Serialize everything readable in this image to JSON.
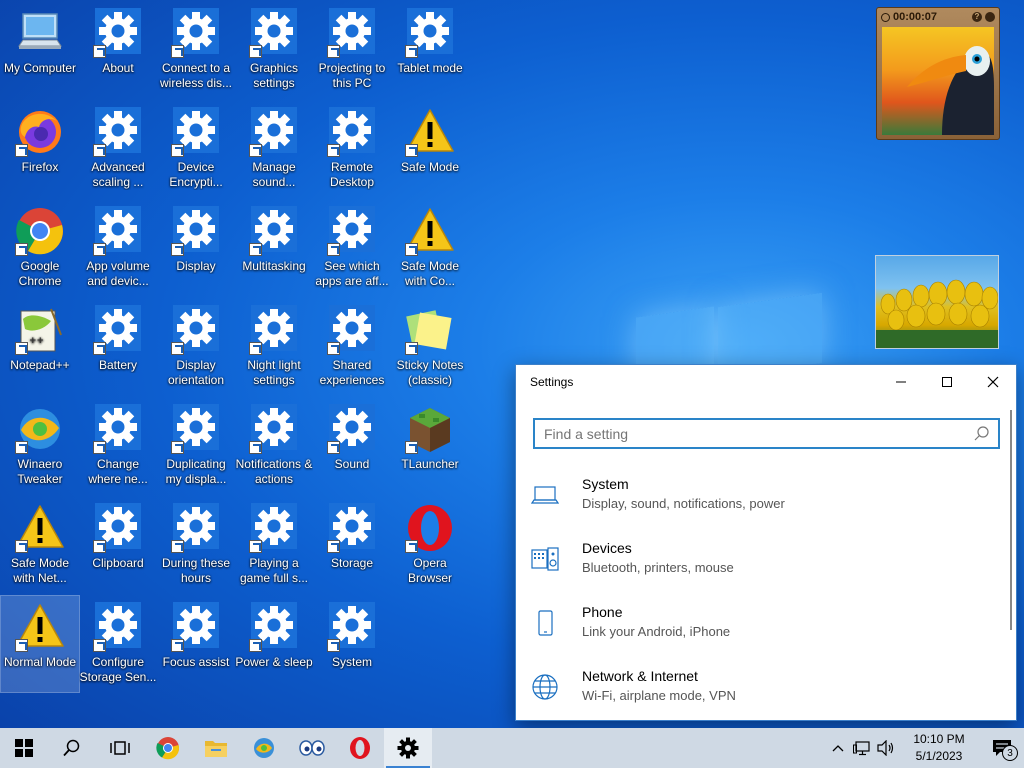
{
  "desktop": {
    "icons": [
      {
        "label": "My Computer",
        "type": "computer"
      },
      {
        "label": "About",
        "type": "gear"
      },
      {
        "label": "Connect to a wireless dis...",
        "type": "gear"
      },
      {
        "label": "Graphics settings",
        "type": "gear"
      },
      {
        "label": "Projecting to this PC",
        "type": "gear"
      },
      {
        "label": "Tablet mode",
        "type": "gear"
      },
      {
        "label": "Firefox",
        "type": "firefox"
      },
      {
        "label": "Advanced scaling ...",
        "type": "gear"
      },
      {
        "label": "Device Encrypti...",
        "type": "gear"
      },
      {
        "label": "Manage sound...",
        "type": "gear"
      },
      {
        "label": "Remote Desktop",
        "type": "gear"
      },
      {
        "label": "Safe Mode",
        "type": "warning"
      },
      {
        "label": "Google Chrome",
        "type": "chrome"
      },
      {
        "label": "App volume and devic...",
        "type": "gear"
      },
      {
        "label": "Display",
        "type": "gear"
      },
      {
        "label": "Multitasking",
        "type": "gear"
      },
      {
        "label": "See which apps are aff...",
        "type": "gear"
      },
      {
        "label": "Safe Mode with Co...",
        "type": "warning"
      },
      {
        "label": "Notepad++",
        "type": "notepad"
      },
      {
        "label": "Battery",
        "type": "gear"
      },
      {
        "label": "Display orientation",
        "type": "gear"
      },
      {
        "label": "Night light settings",
        "type": "gear"
      },
      {
        "label": "Shared experiences",
        "type": "gear"
      },
      {
        "label": "Sticky Notes (classic)",
        "type": "sticky"
      },
      {
        "label": "Winaero Tweaker",
        "type": "winaero"
      },
      {
        "label": "Change where ne...",
        "type": "gear"
      },
      {
        "label": "Duplicating my displa...",
        "type": "gear"
      },
      {
        "label": "Notifications & actions",
        "type": "gear"
      },
      {
        "label": "Sound",
        "type": "gear"
      },
      {
        "label": "TLauncher",
        "type": "tlauncher"
      },
      {
        "label": "Safe Mode with Net...",
        "type": "warning"
      },
      {
        "label": "Clipboard",
        "type": "gear"
      },
      {
        "label": "During these hours",
        "type": "gear"
      },
      {
        "label": "Playing a game full s...",
        "type": "gear"
      },
      {
        "label": "Storage",
        "type": "gear"
      },
      {
        "label": "Opera Browser",
        "type": "opera"
      },
      {
        "label": "Normal Mode",
        "type": "warning"
      },
      {
        "label": "Configure Storage Sen...",
        "type": "gear"
      },
      {
        "label": "Focus assist",
        "type": "gear"
      },
      {
        "label": "Power & sleep",
        "type": "gear"
      },
      {
        "label": "System",
        "type": "gear"
      }
    ]
  },
  "clock_gadget": {
    "time": "00:00:07"
  },
  "settings": {
    "title": "Settings",
    "search_placeholder": "Find a setting",
    "categories": [
      {
        "title": "System",
        "desc": "Display, sound, notifications, power",
        "icon": "laptop-icon"
      },
      {
        "title": "Devices",
        "desc": "Bluetooth, printers, mouse",
        "icon": "keyboard-speaker-icon"
      },
      {
        "title": "Phone",
        "desc": "Link your Android, iPhone",
        "icon": "phone-icon"
      },
      {
        "title": "Network & Internet",
        "desc": "Wi-Fi, airplane mode, VPN",
        "icon": "globe-icon"
      }
    ]
  },
  "taskbar": {
    "time": "10:10 PM",
    "date": "5/1/2023",
    "notification_count": "3"
  },
  "colors": {
    "accent": "#2a84c8",
    "desktop": "#0d5fd0",
    "taskbar": "#cfd9e4"
  }
}
